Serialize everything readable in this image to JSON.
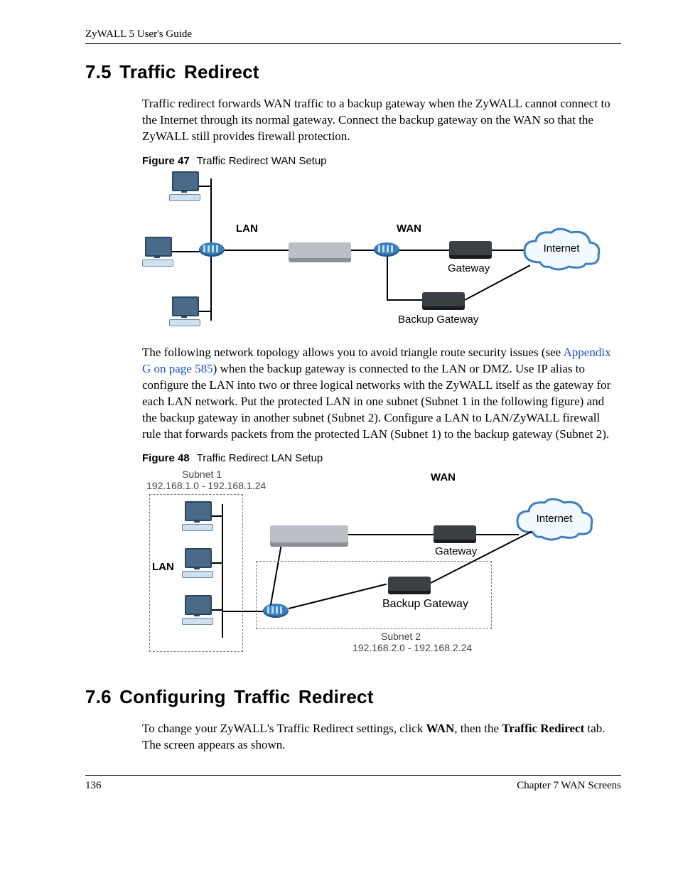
{
  "header": {
    "running": "ZyWALL 5 User's Guide"
  },
  "section75": {
    "heading": "7.5  Traffic Redirect",
    "p1": "Traffic redirect forwards WAN traffic to a backup gateway when the ZyWALL cannot connect to the Internet through its normal gateway. Connect the backup gateway on the WAN so that the ZyWALL still provides firewall protection."
  },
  "fig47": {
    "caption_no": "Figure 47",
    "caption_text": "Traffic Redirect WAN Setup",
    "labels": {
      "lan": "LAN",
      "wan": "WAN",
      "gateway": "Gateway",
      "backup_gateway": "Backup Gateway",
      "internet": "Internet"
    }
  },
  "midpara": {
    "pretext": "The following network topology allows you to avoid triangle route security issues (see ",
    "link": "Appendix G on page 585",
    "posttext": ") when the backup gateway is connected to the LAN or DMZ. Use IP alias to configure the LAN into two or three logical networks with the ZyWALL itself as the gateway for each LAN network. Put the protected LAN in one subnet (Subnet 1 in the following figure) and the backup gateway in another subnet (Subnet 2). Configure a LAN to LAN/ZyWALL firewall rule that forwards packets from the protected LAN (Subnet 1) to the backup gateway (Subnet 2)."
  },
  "fig48": {
    "caption_no": "Figure 48",
    "caption_text": "Traffic Redirect LAN Setup",
    "labels": {
      "subnet1_title": "Subnet 1",
      "subnet1_range": "192.168.1.0 - 192.168.1.24",
      "lan": "LAN",
      "wan": "WAN",
      "gateway": "Gateway",
      "backup_gateway": "Backup Gateway",
      "subnet2_title": "Subnet 2",
      "subnet2_range": "192.168.2.0 - 192.168.2.24",
      "internet": "Internet"
    }
  },
  "section76": {
    "heading": "7.6  Configuring Traffic Redirect",
    "p1_a": "To change your ZyWALL's Traffic Redirect settings, click ",
    "p1_wan": "WAN",
    "p1_b": ", then the ",
    "p1_tr": "Traffic Redirect",
    "p1_c": " tab.  The screen appears as shown."
  },
  "footer": {
    "pageno": "136",
    "chapter": "Chapter 7 WAN Screens"
  }
}
